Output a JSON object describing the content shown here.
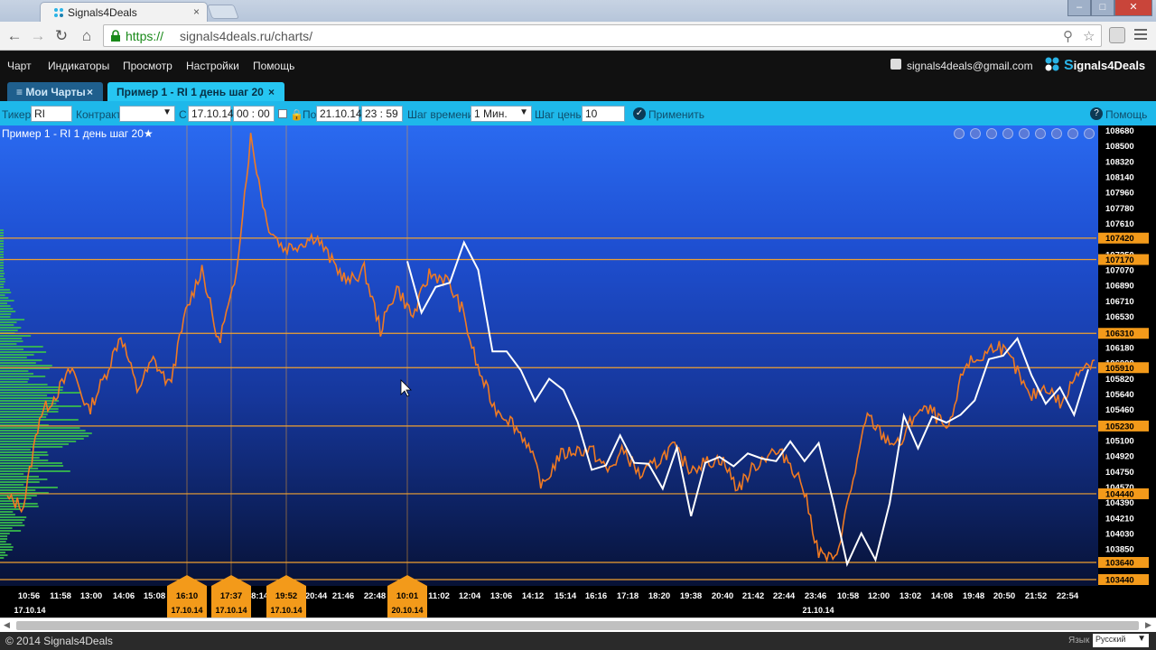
{
  "browser": {
    "tab_title": "Signals4Deals",
    "tab_close": "×",
    "url_scheme": "https://",
    "url_rest": "signals4deals.ru/charts/",
    "window_controls": {
      "minimize": "–",
      "maximize": "□",
      "close": "✕"
    },
    "icons": [
      "back-icon",
      "forward-icon",
      "reload-icon",
      "home-icon",
      "lock-icon",
      "search-icon",
      "star-icon",
      "extension-icon",
      "menu-icon"
    ]
  },
  "app": {
    "menu": [
      "Чарт",
      "Индикаторы",
      "Просмотр",
      "Настройки",
      "Помощь"
    ],
    "user_email": "signals4deals@gmail.com",
    "logo": {
      "prefix": "S",
      "text": "ignals4Deals"
    },
    "tabs": [
      {
        "label": "≡ Мои Чарты",
        "close": "×"
      },
      {
        "label": "Пример 1 - RI 1 день шаг 20",
        "close": "×"
      }
    ]
  },
  "params": {
    "ticker_label": "Тикер",
    "ticker": "RI",
    "contract_label": "Контракт",
    "contract": "",
    "from_label": "С",
    "from_date": "17.10.14",
    "from_time": "00 : 00",
    "to_label": "По",
    "to_date": "21.10.14",
    "to_time": "23 : 59",
    "time_step_label": "Шаг времени",
    "time_step": "1 Мин.",
    "price_step_label": "Шаг цены",
    "price_step": "10",
    "apply_label": "Применить",
    "help_label": "Помощь"
  },
  "chart_data": {
    "type": "line",
    "title": "Пример 1 - RI 1 день шаг 20★",
    "ylim": [
      103440,
      108680
    ],
    "price_ticks": [
      108680,
      108500,
      108320,
      108140,
      107960,
      107780,
      107610,
      107430,
      107250,
      107070,
      106890,
      106710,
      106530,
      106350,
      106180,
      106000,
      105820,
      105640,
      105460,
      105280,
      105100,
      104920,
      104750,
      104570,
      104390,
      104210,
      104030,
      103850,
      103670,
      103440
    ],
    "price_levels": [
      107420,
      107170,
      106310,
      105910,
      105230,
      104440,
      103640,
      103440
    ],
    "time_labels": [
      "10:56",
      "11:58",
      "13:00",
      "14:06",
      "15:08",
      "16:10",
      "17:37",
      "18:14",
      "19:52",
      "20:44",
      "21:46",
      "22:48",
      "10:01",
      "11:02",
      "12:04",
      "13:06",
      "14:12",
      "15:14",
      "16:16",
      "17:18",
      "18:20",
      "19:38",
      "20:40",
      "21:42",
      "22:44",
      "23:46",
      "10:58",
      "12:00",
      "13:02",
      "14:08",
      "19:48",
      "20:50",
      "21:52",
      "22:54"
    ],
    "date_labels": [
      "17.10.14",
      "21.10.14"
    ],
    "markers": [
      {
        "time": "16:10",
        "date": "17.10.14"
      },
      {
        "time": "17:37",
        "date": "17.10.14"
      },
      {
        "time": "19:52",
        "date": "17.10.14"
      },
      {
        "time": "10:01",
        "date": "20.10.14"
      }
    ],
    "series": [
      {
        "values": [
          104380,
          104300,
          105350,
          105600,
          105900,
          105400,
          105800,
          106300,
          105650,
          106000,
          105700,
          106550,
          107080,
          106200,
          106850,
          108600,
          107600,
          107300,
          107350,
          107450,
          107150,
          106900,
          107050,
          106350,
          106850,
          106500,
          107000,
          106950,
          106600,
          105900,
          105450,
          105300,
          105050,
          104520,
          104880,
          104950,
          104950,
          104700,
          104950,
          104650,
          104800,
          104990,
          104740,
          104800,
          104850,
          104500,
          104750,
          104930,
          104870,
          104550,
          103750,
          103650,
          104500,
          105350,
          105100,
          105000,
          105400,
          105400,
          105150,
          105950,
          106020,
          106200,
          105950,
          105550,
          105700,
          105470,
          105900,
          106000
        ]
      },
      {
        "values": [
          107150,
          106550,
          106850,
          106900,
          107370,
          107050,
          106100,
          106100,
          105880,
          105520,
          105780,
          105650,
          105280,
          104720,
          104770,
          105120,
          104800,
          104790,
          104500,
          104980,
          104180,
          104800,
          104870,
          104760,
          104910,
          104850,
          104820,
          105050,
          104820,
          105030,
          104360,
          103620,
          103980,
          103670,
          104330,
          105350,
          104970,
          105340,
          105270,
          105360,
          105530,
          106010,
          106050,
          106250,
          105820,
          105490,
          105680,
          105360,
          105890
        ]
      }
    ],
    "colors": {
      "orange": "#f07a22",
      "white": "#ffffff",
      "level_line": "#f0a030",
      "marker": "#f39a1a"
    }
  },
  "footer": {
    "copyright": "© 2014 Signals4Deals",
    "language_label": "Язык",
    "language": "Русский"
  }
}
